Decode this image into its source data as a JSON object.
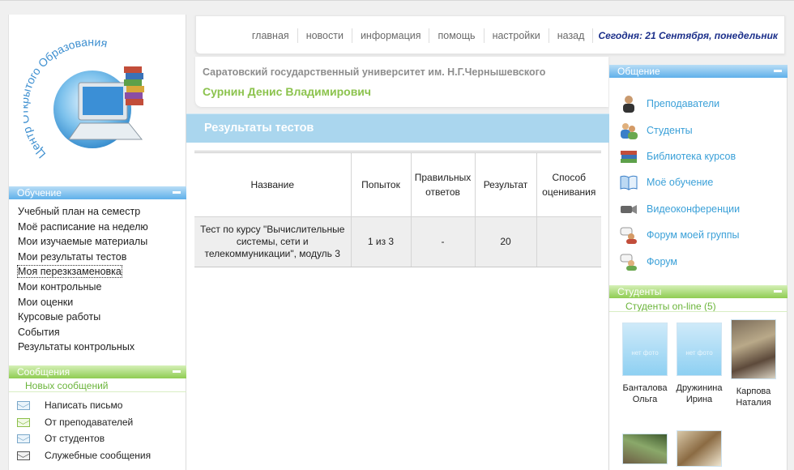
{
  "logo": {
    "arc_text": "Центр Открытого Образования"
  },
  "nav": {
    "items": [
      "главная",
      "новости",
      "информация",
      "помощь",
      "настройки",
      "назад"
    ],
    "today": "Сегодня: 21 Сентября, понедельник"
  },
  "header": {
    "university": "Саратовский государственный университет им. Н.Г.Чернышевского",
    "user": "Сурнин Денис Владимирович"
  },
  "left": {
    "study_title": "Обучение",
    "study_items": [
      "Учебный план на семестр",
      "Моё расписание на неделю",
      "Мои изучаемые материалы",
      "Мои результаты тестов",
      "Моя перезкзаменовка",
      "Мои контрольные",
      "Мои оценки",
      "Курсовые работы",
      "События",
      "Результаты контрольных"
    ],
    "messages_title": "Сообщения",
    "new_messages": "Новых сообщений",
    "message_items": [
      "Написать письмо",
      "От преподавателей",
      "От студентов",
      "Служебные сообщения"
    ]
  },
  "main": {
    "title": "Результаты тестов",
    "table": {
      "headers": [
        "Название",
        "Попыток",
        "Правильных ответов",
        "Результат",
        "Способ оценивания"
      ],
      "rows": [
        [
          "Тест по курсу \"Вычислительные системы, сети и телекоммуникации\", модуль 3",
          "1 из 3",
          "-",
          "20",
          ""
        ]
      ]
    }
  },
  "right": {
    "comm_title": "Общение",
    "comm_items": [
      "Преподаватели",
      "Студенты",
      "Библиотека курсов",
      "Моё обучение",
      "Видеоконференции",
      "Форум моей группы",
      "Форум"
    ],
    "students_title": "Студенты",
    "students_online": "Студенты on-line (5)",
    "students": [
      {
        "name": "Банталова Ольга"
      },
      {
        "name": "Дружинина Ирина"
      },
      {
        "name": "Карпова Наталия"
      }
    ]
  },
  "colors": {
    "accent_blue": "#5fb0ea",
    "accent_green": "#8cc34e",
    "link_blue": "#3aa0d8",
    "date_navy": "#1b2f8a"
  }
}
